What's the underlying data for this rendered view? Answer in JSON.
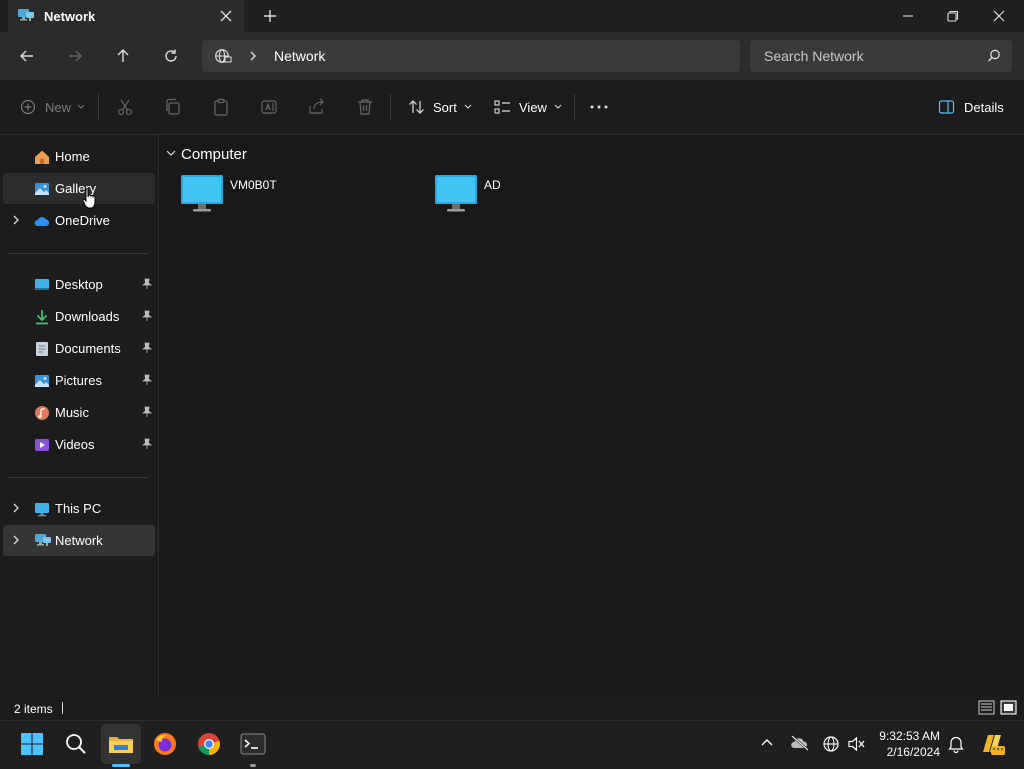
{
  "window": {
    "tab_title": "Network",
    "new_tab_icon": "plus-icon",
    "colors": {
      "background": "#1c1c1c",
      "accent": "#4cc2ff",
      "chrome": "#202020"
    }
  },
  "address": {
    "location": "Network",
    "search_placeholder": "Search Network"
  },
  "commands": {
    "new_label": "New",
    "sort_label": "Sort",
    "view_label": "View",
    "details_label": "Details"
  },
  "sidebar": {
    "items": [
      {
        "label": "Home",
        "icon": "home-icon"
      },
      {
        "label": "Gallery",
        "icon": "gallery-icon"
      },
      {
        "label": "OneDrive",
        "icon": "onedrive-icon"
      },
      {
        "label": "Desktop",
        "icon": "desktop-icon"
      },
      {
        "label": "Downloads",
        "icon": "downloads-icon"
      },
      {
        "label": "Documents",
        "icon": "documents-icon"
      },
      {
        "label": "Pictures",
        "icon": "pictures-icon"
      },
      {
        "label": "Music",
        "icon": "music-icon"
      },
      {
        "label": "Videos",
        "icon": "videos-icon"
      },
      {
        "label": "This PC",
        "icon": "this-pc-icon"
      },
      {
        "label": "Network",
        "icon": "network-icon"
      }
    ]
  },
  "content": {
    "group_label": "Computer",
    "items": [
      {
        "label": "VM0B0T",
        "icon": "computer-icon"
      },
      {
        "label": "AD",
        "icon": "computer-icon"
      }
    ]
  },
  "status": {
    "item_count": "2 items"
  },
  "taskbar": {
    "time": "9:32:53 AM",
    "date": "2/16/2024"
  }
}
